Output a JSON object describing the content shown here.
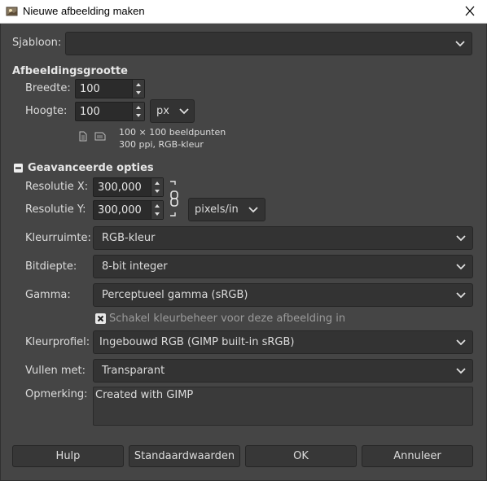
{
  "window": {
    "title": "Nieuwe afbeelding maken",
    "icon": "gimp-icon",
    "close_icon": "close-icon"
  },
  "template": {
    "label": "Sjabloon:",
    "value": ""
  },
  "image_size": {
    "heading": "Afbeeldingsgrootte",
    "width_label": "Breedte:",
    "width_value": "100",
    "height_label": "Hoogte:",
    "height_value": "100",
    "unit": "px",
    "info_line1": "100 × 100 beeldpunten",
    "info_line2": "300 ppi, RGB-kleur"
  },
  "advanced": {
    "heading": "Geavanceerde opties",
    "expanded": true,
    "res_x_label": "Resolutie X:",
    "res_x_value": "300,000",
    "res_y_label": "Resolutie Y:",
    "res_y_value": "300,000",
    "res_unit": "pixels/in",
    "colorspace_label": "Kleurruimte:",
    "colorspace_value": "RGB-kleur",
    "precision_label": "Bitdiepte:",
    "precision_value": "8-bit integer",
    "gamma_label": "Gamma:",
    "gamma_value": "Perceptueel gamma (sRGB)",
    "color_manage_label": "Schakel kleurbeheer voor deze afbeelding in",
    "color_manage_checked": true,
    "profile_label": "Kleurprofiel:",
    "profile_value": "Ingebouwd RGB (GIMP built-in sRGB)",
    "fill_label": "Vullen met:",
    "fill_value": "Transparant",
    "comment_label": "Opmerking:",
    "comment_value": "Created with GIMP"
  },
  "buttons": {
    "help": "Hulp",
    "reset": "Standaardwaarden",
    "ok": "OK",
    "cancel": "Annuleer"
  },
  "colors": {
    "background": "#454545",
    "field": "#333333",
    "text": "#dcdcdc"
  }
}
